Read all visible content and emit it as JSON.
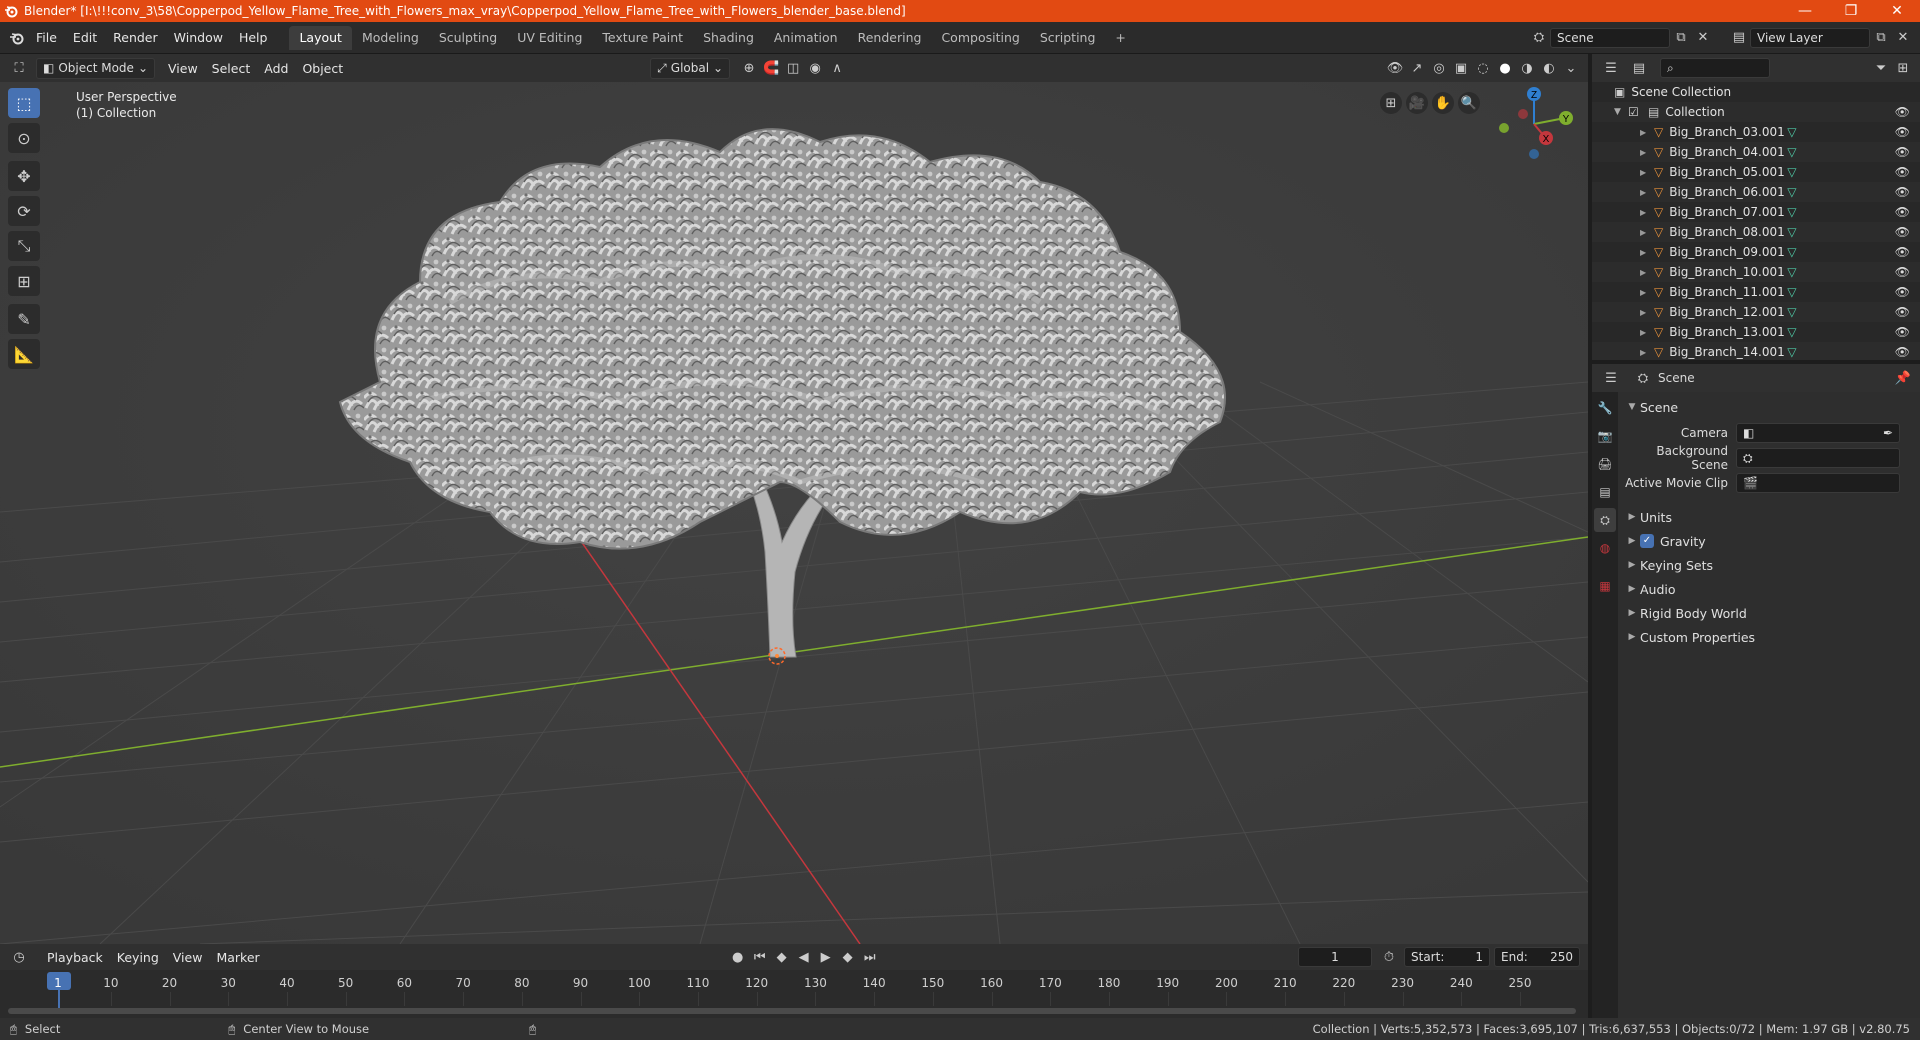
{
  "titlebar": {
    "title": "Blender* [I:\\!!!conv_3\\58\\Copperpod_Yellow_Flame_Tree_with_Flowers_max_vray\\Copperpod_Yellow_Flame_Tree_with_Flowers_blender_base.blend]",
    "minimize": "—",
    "restore": "❐",
    "close": "✕"
  },
  "menu": [
    "File",
    "Edit",
    "Render",
    "Window",
    "Help"
  ],
  "workspaces": {
    "tabs": [
      "Layout",
      "Modeling",
      "Sculpting",
      "UV Editing",
      "Texture Paint",
      "Shading",
      "Animation",
      "Rendering",
      "Compositing",
      "Scripting"
    ],
    "active": "Layout",
    "add": "+"
  },
  "scene_field": "Scene",
  "view_layer_field": "View Layer",
  "viewport_header": {
    "mode": "Object Mode",
    "menus": [
      "View",
      "Select",
      "Add",
      "Object"
    ],
    "orientation": "Global"
  },
  "viewport": {
    "perspective": "User Perspective",
    "collection": "(1) Collection",
    "gizmo": {
      "x": "X",
      "y": "Y",
      "z": "Z"
    }
  },
  "timeline": {
    "menus": [
      "Playback",
      "Keying",
      "View",
      "Marker"
    ],
    "current_frame": "1",
    "start_label": "Start:",
    "start": "1",
    "end_label": "End:",
    "end": "250",
    "ticks": [
      "1",
      "10",
      "20",
      "30",
      "40",
      "50",
      "60",
      "70",
      "80",
      "90",
      "100",
      "110",
      "120",
      "130",
      "140",
      "150",
      "160",
      "170",
      "180",
      "190",
      "200",
      "210",
      "220",
      "230",
      "240",
      "250"
    ]
  },
  "statusbar": {
    "select": "Select",
    "center_view": "Center View to Mouse",
    "stats": "Collection | Verts:5,352,573 | Faces:3,695,107 | Tris:6,637,553 | Objects:0/72 | Mem: 1.97 GB | v2.80.75"
  },
  "outliner": {
    "scene_collection": "Scene Collection",
    "collection": "Collection",
    "items": [
      "Big_Branch_03.001",
      "Big_Branch_04.001",
      "Big_Branch_05.001",
      "Big_Branch_06.001",
      "Big_Branch_07.001",
      "Big_Branch_08.001",
      "Big_Branch_09.001",
      "Big_Branch_10.001",
      "Big_Branch_11.001",
      "Big_Branch_12.001",
      "Big_Branch_13.001",
      "Big_Branch_14.001"
    ]
  },
  "properties": {
    "context": "Scene",
    "section": "Scene",
    "camera_label": "Camera",
    "background_scene_label": "Background Scene",
    "active_movie_clip_label": "Active Movie Clip",
    "panels": [
      "Units",
      "Gravity",
      "Keying Sets",
      "Audio",
      "Rigid Body World",
      "Custom Properties"
    ],
    "gravity_checked": true
  },
  "colors": {
    "titlebar": "#e24a12",
    "accent": "#4772b3",
    "x_axis": "#c4373d",
    "y_axis": "#7fae2e",
    "z_axis": "#2f7fd1",
    "mesh_icon": "#e8913a",
    "data_icon": "#4fc9a5"
  }
}
